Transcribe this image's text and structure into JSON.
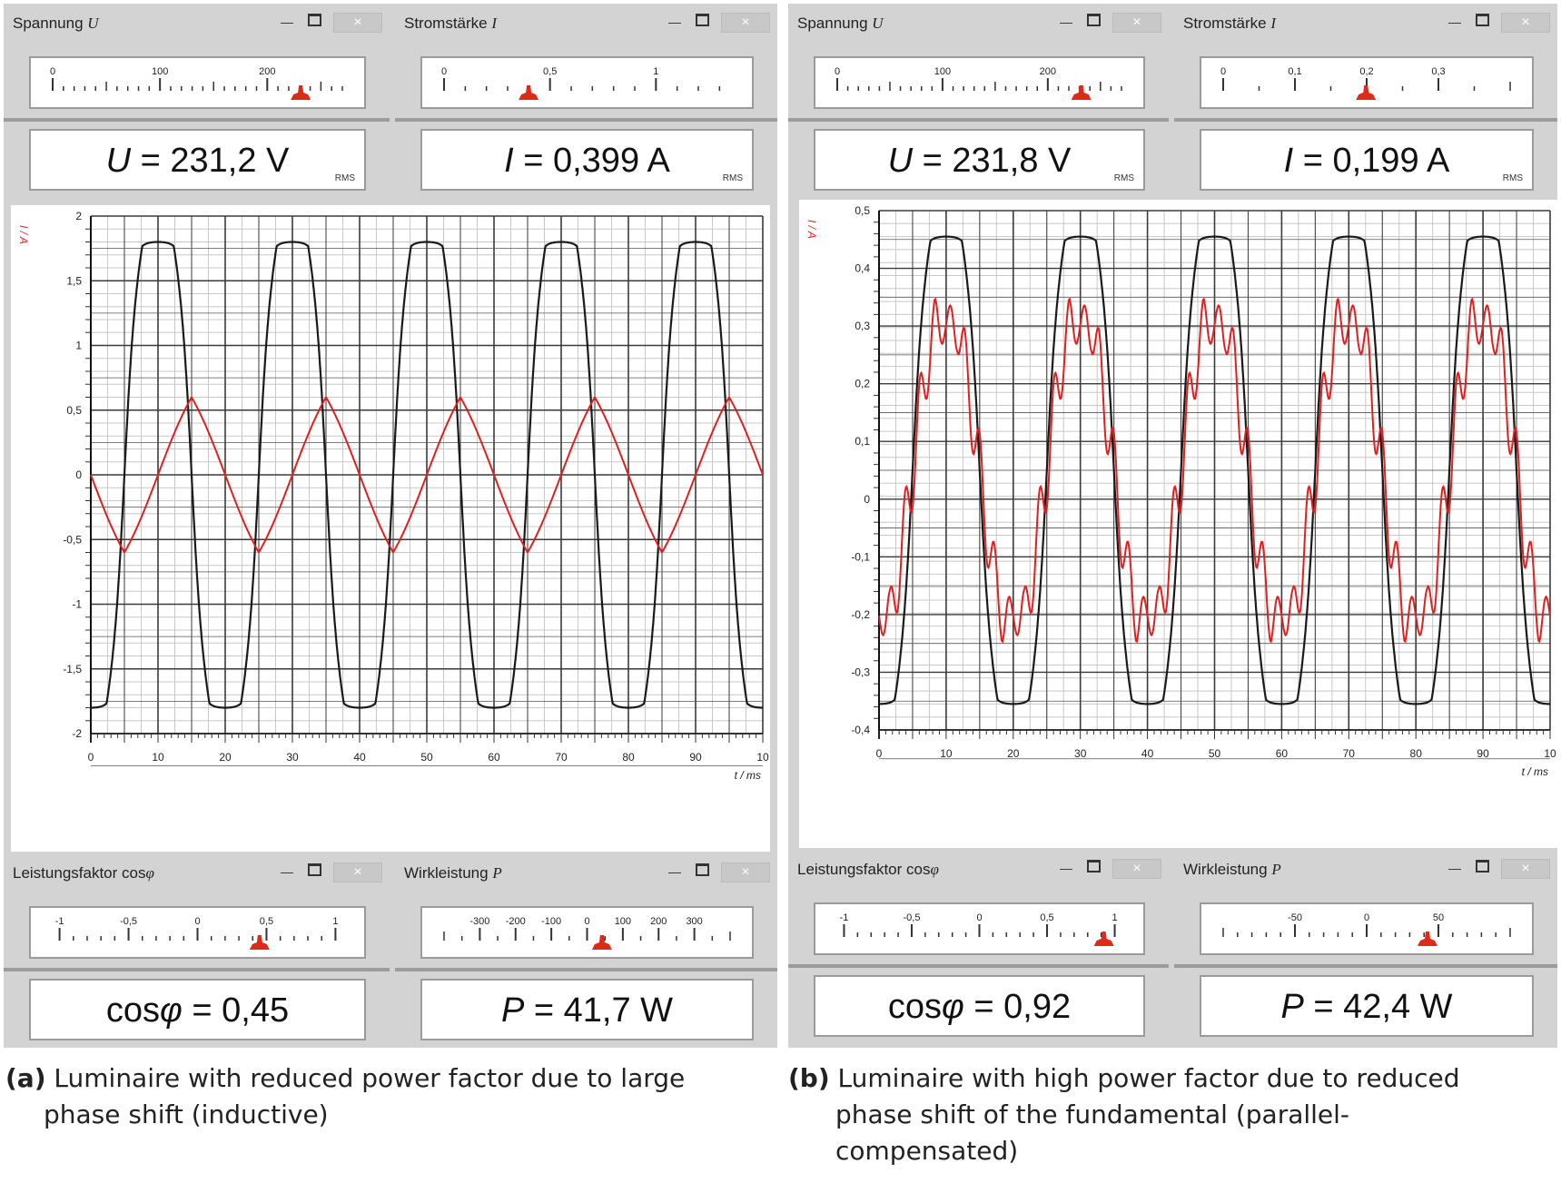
{
  "panels": {
    "a": {
      "voltage": {
        "title_label": "Spannung",
        "title_symbol": "U",
        "symbol": "U",
        "eq": "=",
        "value": "231,2 V",
        "rms": "RMS",
        "scale": {
          "min": 0,
          "max": 270,
          "labels": [
            "0",
            "100",
            "200"
          ],
          "label_values": [
            0,
            100,
            200
          ],
          "minor_step": 10,
          "major_step": 50,
          "pointer": 231.2
        }
      },
      "current": {
        "title_label": "Stromstärke",
        "title_symbol": "I",
        "symbol": "I",
        "eq": "=",
        "value": "0,399 A",
        "rms": "RMS",
        "scale": {
          "min": 0,
          "max": 1.35,
          "labels": [
            "0",
            "0,5",
            "1"
          ],
          "label_values": [
            0,
            0.5,
            1
          ],
          "minor_step": 0.1,
          "major_step": 0.5,
          "pointer": 0.399
        }
      },
      "powerfactor": {
        "title_label": "Leistungsfaktor cos",
        "title_symbol": "φ",
        "symbol": "cos",
        "symbol2": "φ",
        "eq": "=",
        "value": "0,45",
        "scale": {
          "min": -1.05,
          "max": 1.05,
          "labels": [
            "-1",
            "-0,5",
            "0",
            "0,5",
            "1"
          ],
          "label_values": [
            -1,
            -0.5,
            0,
            0.5,
            1
          ],
          "minor_step": 0.1,
          "major_step": 0.5,
          "pointer": 0.45
        }
      },
      "power": {
        "title_label": "Wirkleistung",
        "title_symbol": "P",
        "symbol": "P",
        "eq": "=",
        "value": "41,7 W",
        "scale": {
          "min": -400,
          "max": 400,
          "labels": [
            "-300",
            "-200",
            "-100",
            "0",
            "100",
            "200",
            "300"
          ],
          "label_values": [
            -300,
            -200,
            -100,
            0,
            100,
            200,
            300
          ],
          "minor_step": 50,
          "major_step": 100,
          "pointer": 41.7
        }
      },
      "graph": {
        "y_axis_label": "I / A",
        "x_axis_label": "t / ms",
        "y_tick_labels": [
          "2",
          "1,5",
          "1",
          "0,5",
          "0",
          "-0,5",
          "-1",
          "-1,5",
          "-2"
        ],
        "x_tick_labels": [
          "0",
          "10",
          "20",
          "30",
          "40",
          "50",
          "60",
          "70",
          "80",
          "90",
          "10"
        ]
      }
    },
    "b": {
      "voltage": {
        "title_label": "Spannung",
        "title_symbol": "U",
        "symbol": "U",
        "eq": "=",
        "value": "231,8 V",
        "rms": "RMS",
        "scale": {
          "min": 0,
          "max": 270,
          "labels": [
            "0",
            "100",
            "200"
          ],
          "label_values": [
            0,
            100,
            200
          ],
          "minor_step": 10,
          "major_step": 50,
          "pointer": 231.8
        }
      },
      "current": {
        "title_label": "Stromstärke",
        "title_symbol": "I",
        "symbol": "I",
        "eq": "=",
        "value": "0,199 A",
        "rms": "RMS",
        "scale": {
          "min": 0,
          "max": 0.4,
          "labels": [
            "0",
            "0,1",
            "0,2",
            "0,3"
          ],
          "label_values": [
            0,
            0.1,
            0.2,
            0.3
          ],
          "minor_step": 0.05,
          "major_step": 0.1,
          "pointer": 0.199
        }
      },
      "powerfactor": {
        "title_label": "Leistungsfaktor cos",
        "title_symbol": "φ",
        "symbol": "cos",
        "symbol2": "φ",
        "eq": "=",
        "value": "0,92",
        "scale": {
          "min": -1.05,
          "max": 1.05,
          "labels": [
            "-1",
            "-0,5",
            "0",
            "0,5",
            "1"
          ],
          "label_values": [
            -1,
            -0.5,
            0,
            0.5,
            1
          ],
          "minor_step": 0.1,
          "major_step": 0.5,
          "pointer": 0.92
        }
      },
      "power": {
        "title_label": "Wirkleistung",
        "title_symbol": "P",
        "symbol": "P",
        "eq": "=",
        "value": "42,4 W",
        "scale": {
          "min": -100,
          "max": 100,
          "labels": [
            "-50",
            "0",
            "50"
          ],
          "label_values": [
            -50,
            0,
            50
          ],
          "minor_step": 10,
          "major_step": 50,
          "pointer": 42.4
        }
      },
      "graph": {
        "y_axis_label": "I / A",
        "x_axis_label": "t / ms",
        "y_tick_labels": [
          "0,5",
          "0,4",
          "0,3",
          "0,2",
          "0,1",
          "0",
          "-0,1",
          "-0,2",
          "-0,3",
          "-0,4"
        ],
        "x_tick_labels": [
          "0",
          "10",
          "20",
          "30",
          "40",
          "50",
          "60",
          "70",
          "80",
          "90",
          "10"
        ]
      }
    }
  },
  "chart_data": [
    {
      "type": "line",
      "panel": "a",
      "xlabel": "t / ms",
      "ylabel": "I / A",
      "xlim": [
        0,
        100
      ],
      "ylim": [
        -2,
        2
      ],
      "series": [
        {
          "color": "#1a1a1a",
          "shape": "clipped-sine",
          "amplitude": 1.8,
          "period_ms": 20,
          "peak_at_ms": 10
        },
        {
          "color": "#e02020",
          "shape": "triangular",
          "amplitude": 0.6,
          "period_ms": 20,
          "peak_at_ms": 15
        }
      ]
    },
    {
      "type": "line",
      "panel": "b",
      "xlabel": "t / ms",
      "ylabel": "I / A",
      "xlim": [
        0,
        100
      ],
      "ylim": [
        -0.5,
        0.5
      ],
      "series": [
        {
          "color": "#1a1a1a",
          "shape": "clipped-sine",
          "amplitude": 0.45,
          "period_ms": 20,
          "peak_at_ms": 10
        },
        {
          "color": "#e02020",
          "shape": "sine-with-ripple",
          "amplitude": 0.33,
          "period_ms": 20,
          "peak_at_ms": 10
        }
      ]
    }
  ],
  "captions": {
    "a": {
      "tag": "(a)",
      "line1": "Luminaire with reduced power factor due to large",
      "line2": "phase shift (inductive)"
    },
    "b": {
      "tag": "(b)",
      "line1": "Luminaire with high power factor due to reduced",
      "line2": "phase shift of the fundamental (parallel-",
      "line3": "compensated)"
    }
  },
  "colors": {
    "voltage_trace": "#1a1a1a",
    "current_trace": "#e02020",
    "pointer": "#dd2a1a",
    "frame_bg": "#d3d3d3"
  }
}
